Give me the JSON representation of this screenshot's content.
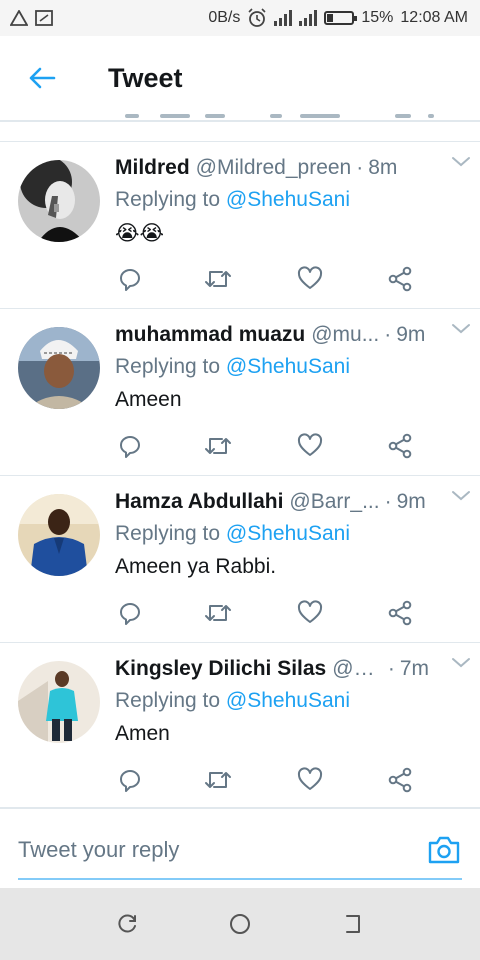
{
  "status_bar": {
    "data_rate": "0B/s",
    "battery_percent": "15%",
    "time": "12:08 AM",
    "icons": [
      "warning-icon",
      "screenshot-icon",
      "alarm-icon",
      "signal-icon",
      "signal-h-icon",
      "battery-charging-icon"
    ]
  },
  "header": {
    "title": "Tweet",
    "back_icon": "arrow-left-icon"
  },
  "colors": {
    "accent": "#1da1f2",
    "secondary_text": "#657786",
    "primary_text": "#14171a",
    "divider": "#e1e8ed"
  },
  "tweets": [
    {
      "name": "Mildred",
      "handle": "@Mildred_preen",
      "separator": "·",
      "time": "8m",
      "reply_prefix": "Replying to",
      "reply_to": "@ShehuSani",
      "text": "😭😭"
    },
    {
      "name": "muhammad muazu",
      "handle": "@mu...",
      "separator": "·",
      "time": "9m",
      "reply_prefix": "Replying to",
      "reply_to": "@ShehuSani",
      "text": "Ameen"
    },
    {
      "name": "Hamza Abdullahi",
      "handle": "@Barr_...",
      "separator": "·",
      "time": "9m",
      "reply_prefix": "Replying to",
      "reply_to": "@ShehuSani",
      "text": "Ameen ya Rabbi."
    },
    {
      "name": "Kingsley Dilichi Silas",
      "handle": "@D...",
      "separator": "·",
      "time": "7m",
      "reply_prefix": "Replying to",
      "reply_to": "@ShehuSani",
      "text": "Amen"
    }
  ],
  "action_icons": [
    "reply-icon",
    "retweet-icon",
    "like-icon",
    "share-icon"
  ],
  "reply_bar": {
    "placeholder": "Tweet your reply",
    "camera_icon": "camera-icon"
  },
  "nav_bar": {
    "icons": [
      "recent-apps-icon",
      "home-icon",
      "back-icon"
    ]
  }
}
